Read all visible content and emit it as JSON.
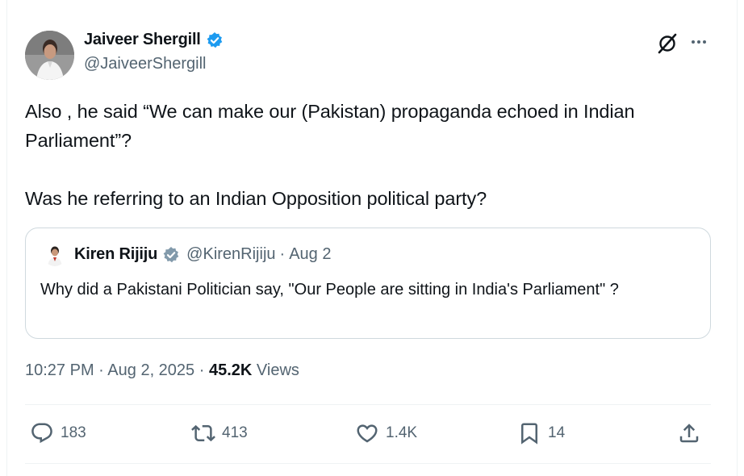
{
  "author": {
    "name": "Jaiveer Shergill",
    "handle": "@JaiveerShergill",
    "verified_color": "#1d9bf0"
  },
  "tweet": {
    "paragraphs": [
      "Also , he said “We can make our (Pakistan) propaganda echoed in Indian Parliament”?",
      "Was he referring to an Indian Opposition political party?"
    ]
  },
  "quoted": {
    "name": "Kiren Rijiju",
    "handle": "@KirenRijiju",
    "separator": "·",
    "date": "Aug 2",
    "verified_color": "#829aab",
    "text": "Why did a Pakistani Politician say, \"Our People are sitting in  India's Parliament\" ?"
  },
  "meta": {
    "time": "10:27 PM",
    "separator": "·",
    "date": "Aug 2, 2025",
    "views_count": "45.2K",
    "views_label": "Views"
  },
  "actions": {
    "replies": "183",
    "reposts": "413",
    "likes": "1.4K",
    "bookmarks": "14"
  },
  "icons": [
    "grok-icon",
    "more-icon",
    "verified-badge-icon",
    "reply-icon",
    "repost-icon",
    "like-icon",
    "bookmark-icon",
    "share-icon"
  ],
  "colors": {
    "text": "#0f1419",
    "secondary": "#536471",
    "border": "#cfd9de"
  }
}
